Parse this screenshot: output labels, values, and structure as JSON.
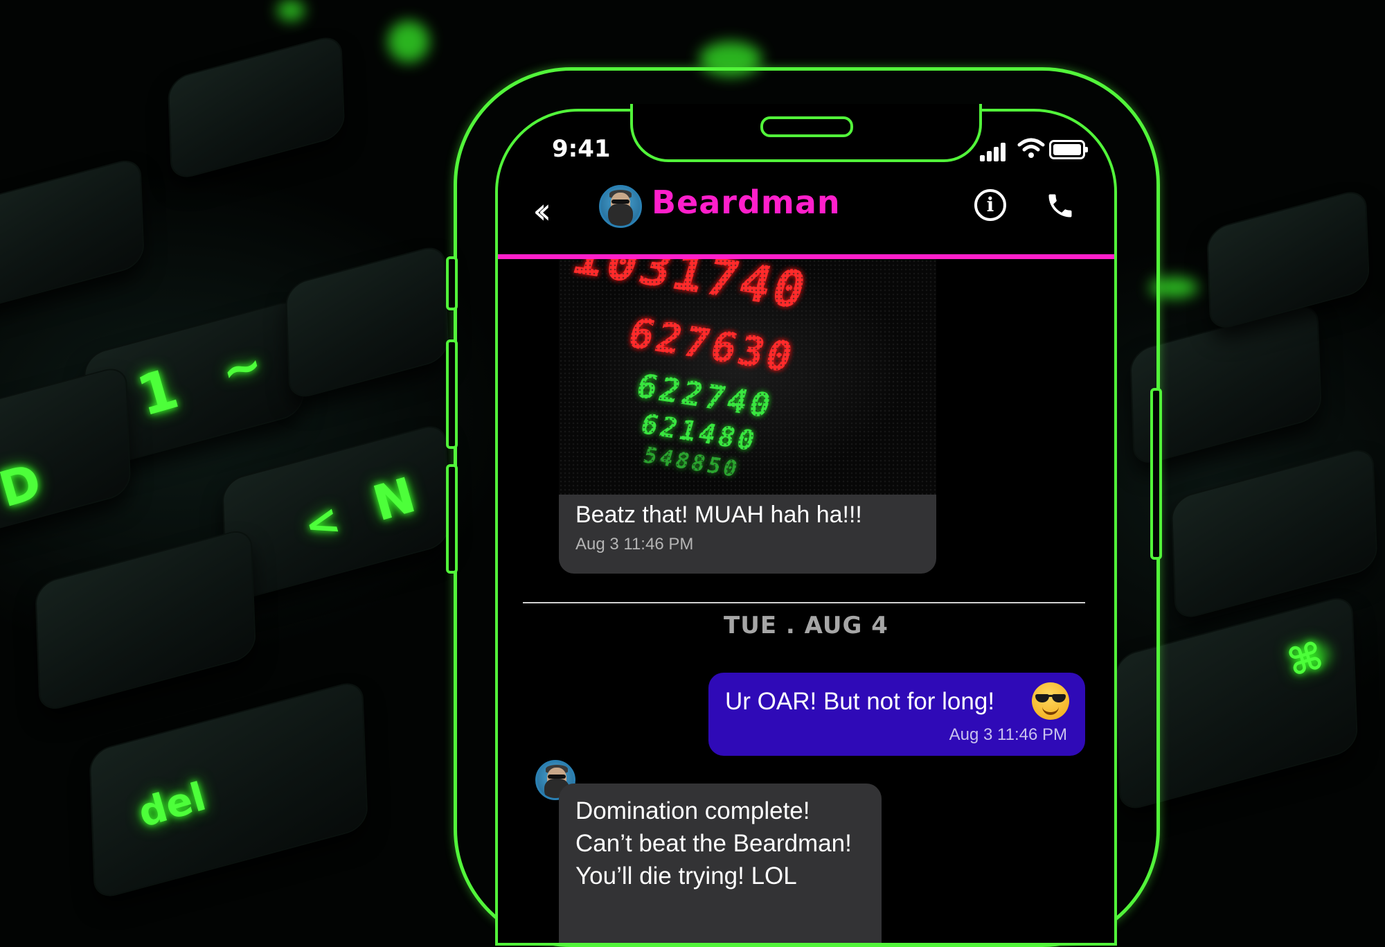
{
  "status_bar": {
    "time": "9:41"
  },
  "header": {
    "back_icon": "double-chevron-left-icon",
    "contact_name": "Beardman",
    "info_icon": "info-icon",
    "call_icon": "phone-icon"
  },
  "colors": {
    "phone_outline": "#52f53a",
    "header_accent": "#ff1fcb",
    "sent_bubble": "#2f0ab7",
    "received_bubble": "#333335"
  },
  "messages": {
    "image_message": {
      "ticker_numbers": [
        "1031740",
        "627630",
        "622740",
        "621480",
        "548850"
      ],
      "caption": "Beatz that! MUAH hah ha!!!",
      "time": "Aug 3 11:46 PM"
    },
    "day_separator": "TUE . AUG 4",
    "sent": {
      "text": "Ur OAR! But not for long!",
      "emoji": "smiling-face-with-sunglasses",
      "time": "Aug 3 11:46 PM"
    },
    "received": {
      "lines": [
        "Domination complete!",
        "Can’t beat the Beardman!",
        "You’ll die trying! LOL"
      ]
    }
  }
}
